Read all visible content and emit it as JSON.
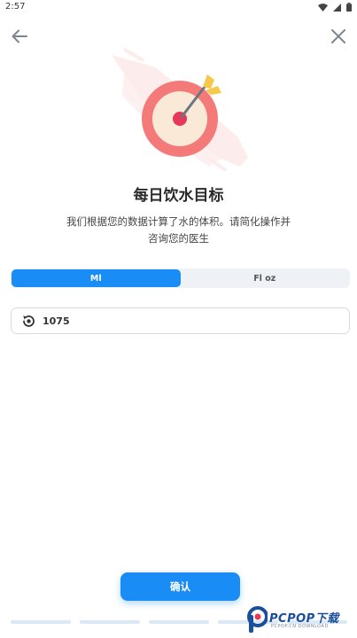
{
  "status_bar": {
    "time": "2:57"
  },
  "header": {
    "back_icon": "arrow-left-icon",
    "close_icon": "close-icon"
  },
  "hero": {
    "icon": "target-with-arrow-illustration"
  },
  "goal": {
    "title": "每日饮水目标",
    "description": "我们根据您的数据计算了水的体积。请简化操作并咨询您的医生"
  },
  "unit_toggle": {
    "options": [
      "Ml",
      "Fl oz"
    ],
    "selected": "Ml"
  },
  "amount_field": {
    "icon": "reset-icon",
    "value": "1075"
  },
  "confirm_button": {
    "label": "确认"
  },
  "watermark": {
    "brand": "PCPOP下载",
    "sub": "PCPOP.CN DOWNLOAD"
  },
  "colors": {
    "accent": "#1a8cf5",
    "target_red": "#f47a7a",
    "arrow_yellow": "#f7c84a"
  }
}
